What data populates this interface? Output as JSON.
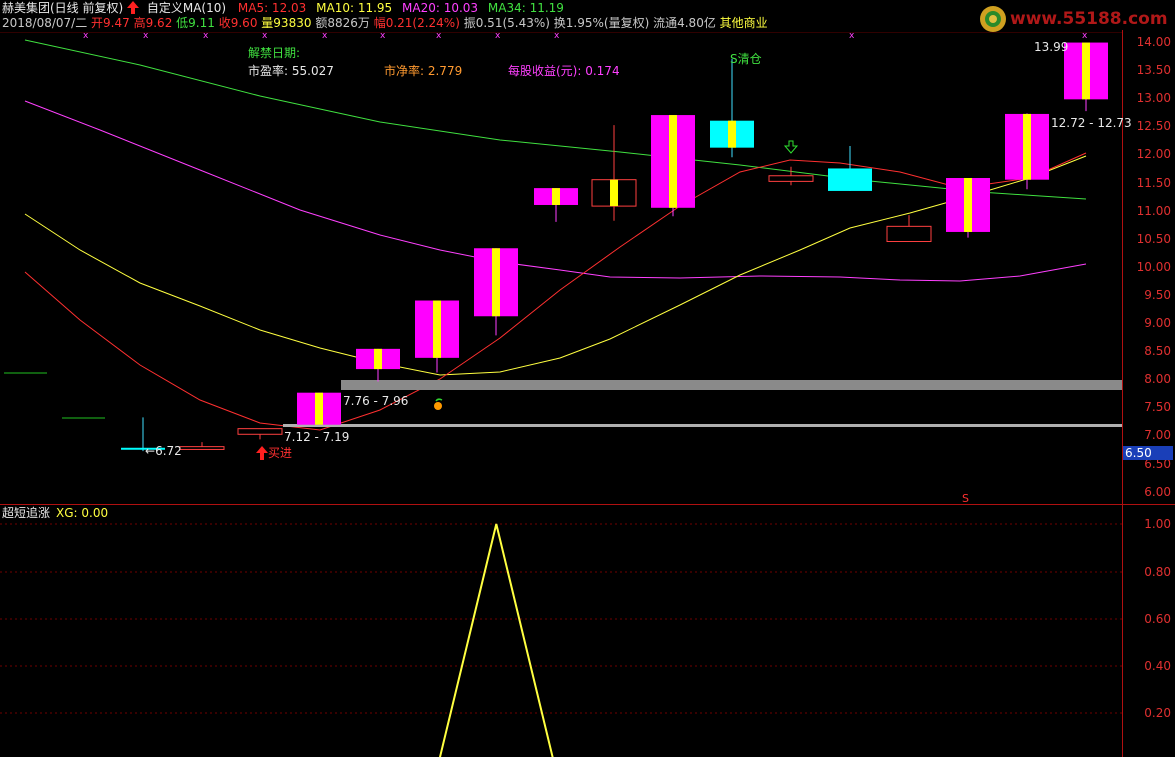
{
  "header": {
    "stock_name": "赫美集团(日线 前复权)",
    "custom_ma": "自定义MA(10)",
    "ma5": "MA5: 12.03",
    "ma10": "MA10: 11.95",
    "ma20": "MA20: 10.03",
    "ma34": "MA34: 11.19"
  },
  "quote": {
    "date": "2018/08/07/二",
    "open": "开9.47",
    "high": "高9.62",
    "low": "低9.11",
    "close": "收9.60",
    "volume": "量93830",
    "amount": "额8826万",
    "change": "幅0.21(2.24%)",
    "amplitude": "振0.51(5.43%)",
    "turnover": "换1.95%(量复权)",
    "float_cap": "流通4.80亿",
    "sector": "其他商业"
  },
  "info": {
    "unlock_label": "解禁日期:",
    "pe_label": "市盈率: 55.027",
    "pb_label": "市净率: 2.779",
    "eps_label": "每股收益(元): 0.174"
  },
  "annotations": {
    "sell_clear": "S清仓",
    "buy_in": "买进",
    "s_marker": "S",
    "low_672": "6.72",
    "range_776": "7.76 - 7.96",
    "range_712": "7.12 - 7.19",
    "range_1272": "12.72 - 12.73",
    "high_1399": "13.99"
  },
  "price_axis": [
    "14.00",
    "13.50",
    "13.00",
    "12.50",
    "12.00",
    "11.50",
    "11.00",
    "10.50",
    "10.00",
    "9.50",
    "9.00",
    "8.50",
    "8.00",
    "7.50",
    "7.00",
    "6.50",
    "6.00"
  ],
  "current_price_tag": "6.50",
  "indicator": {
    "title": "超短追涨",
    "value": "XG: 0.00",
    "axis": [
      "1.00",
      "0.80",
      "0.60",
      "0.40",
      "0.20"
    ]
  },
  "logo": {
    "text": "www.55188.com"
  },
  "colors": {
    "up": "#ff00ff",
    "down": "#00ffff",
    "ma5": "#ff3030",
    "ma10": "#ffff40",
    "ma20": "#ff40ff",
    "ma34": "#40e040",
    "axis": "#b01010"
  },
  "chart_data": {
    "type": "candlestick",
    "candles": [
      {
        "o": 6.78,
        "h": 7.32,
        "l": 6.72,
        "c": 6.78,
        "up": false
      },
      {
        "o": 6.75,
        "h": 6.88,
        "l": 6.75,
        "c": 6.8,
        "up": false
      },
      {
        "o": 7.02,
        "h": 7.12,
        "l": 6.93,
        "c": 7.12,
        "up": false
      },
      {
        "o": 7.19,
        "h": 7.76,
        "l": 7.19,
        "c": 7.76,
        "up": true
      },
      {
        "o": 8.18,
        "h": 8.54,
        "l": 7.96,
        "c": 8.54,
        "up": true
      },
      {
        "o": 8.38,
        "h": 9.4,
        "l": 8.12,
        "c": 9.4,
        "up": true
      },
      {
        "o": 9.12,
        "h": 10.33,
        "l": 8.78,
        "c": 10.33,
        "up": true
      },
      {
        "o": 11.1,
        "h": 11.4,
        "l": 10.8,
        "c": 11.4,
        "up": true
      },
      {
        "o": 11.08,
        "h": 12.52,
        "l": 10.82,
        "c": 11.55,
        "up": false
      },
      {
        "o": 11.05,
        "h": 12.7,
        "l": 10.9,
        "c": 12.7,
        "up": true
      },
      {
        "o": 12.6,
        "h": 13.7,
        "l": 11.95,
        "c": 12.12,
        "up": false
      },
      {
        "o": 11.62,
        "h": 11.78,
        "l": 11.45,
        "c": 11.52,
        "up": false
      },
      {
        "o": 11.75,
        "h": 12.15,
        "l": 11.35,
        "c": 11.35,
        "up": false
      },
      {
        "o": 10.45,
        "h": 10.92,
        "l": 10.45,
        "c": 10.72,
        "up": false
      },
      {
        "o": 10.62,
        "h": 11.58,
        "l": 10.52,
        "c": 11.58,
        "up": true
      },
      {
        "o": 11.55,
        "h": 12.73,
        "l": 11.38,
        "c": 12.72,
        "up": true
      },
      {
        "o": 12.98,
        "h": 13.99,
        "l": 12.77,
        "c": 13.99,
        "up": true
      }
    ],
    "indicator_series": [
      0,
      0,
      0,
      0,
      0,
      0,
      0,
      0,
      0,
      1,
      0,
      0,
      0,
      0,
      0,
      0,
      0,
      0,
      0,
      0
    ]
  }
}
